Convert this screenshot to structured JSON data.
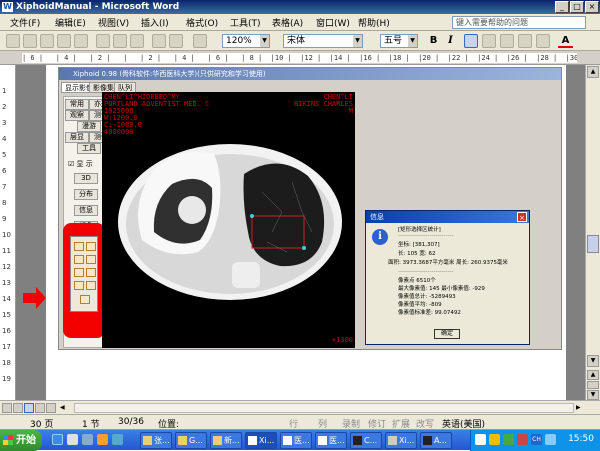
{
  "window": {
    "title": "XiphoidManual - Microsoft Word"
  },
  "menu": {
    "items": [
      "文件(F)",
      "编辑(E)",
      "视图(V)",
      "插入(I)",
      "格式(O)",
      "工具(T)",
      "表格(A)",
      "窗口(W)",
      "帮助(H)"
    ],
    "help_placeholder": "键入需要帮助的问题"
  },
  "toolbar": {
    "zoom": "120%",
    "font": "宋体",
    "size": "五号",
    "bold": "B",
    "italic": "I",
    "font_color": "A"
  },
  "ruler": {
    "text": "| 6 |   | 4 |   | 2 |   |   | 2 |   | 4 |   | 6 |   | 8 |  |10 |  |12 |  |14 |  |16 |  |18 |  |20 |  |22 |  |24 |  |26 |  |28 |  |30 |  |32 |  |34 |  |36 |  |38 |  |40 |  |42 |  |44 |  |46 |  |48 |"
  },
  "vruler": [
    "1",
    "2",
    "3",
    "4",
    "5",
    "6",
    "7",
    "8",
    "9",
    "10",
    "11",
    "12",
    "13",
    "14",
    "15",
    "16",
    "17",
    "18",
    "19"
  ],
  "xiphoid": {
    "title": "Xiphoid 0.98 (骨科软件:华西医科大学)(只供研究和学习使用)",
    "tabs": [
      "显示影像",
      "影像集",
      "队列"
    ],
    "left_buttons": [
      "常用",
      "亦形",
      "观察",
      "测位",
      "漫游",
      "层显",
      "测位",
      "工具"
    ],
    "checkbox_label": "显 示",
    "buttons": [
      "3D",
      "分布",
      "信息",
      "颜色",
      "操作"
    ],
    "ct_text_left": [
      "CHEN^LI^HIDEBED^MY",
      "PORTLAND ADVENTIST MED. C",
      "1025000",
      "W:1200.0",
      "C:-1080.0",
      "4000000"
    ],
    "ct_text_right": [
      "CHEN^LI",
      "BIKINS CHARLES",
      "M"
    ],
    "ct_window": "+1300",
    "dialog": {
      "title": "信息",
      "icon": "info-icon",
      "lines": [
        "[矩形选择区统计]",
        "----------------------------",
        "坐标: [381,307]",
        "长: 105 宽: 62",
        "面积: 3973.3687平方毫米   周长: 260.9375毫米",
        "----------------------------",
        "像素点 6510个",
        "最大像素值: 145  最小像素值: -929",
        "像素值总计: -5289493",
        "像素值平均: -809",
        "像素值标准差: 99.07492"
      ],
      "ok": "确定"
    }
  },
  "status": {
    "page": "30 页",
    "section": "1 节",
    "pos": "30/36",
    "at": "位置:",
    "row": "行",
    "col": "列",
    "rec": "录制",
    "rev": "修订",
    "ext": "扩展",
    "ovr": "改写",
    "lang": "英语(美国)"
  },
  "taskbar": {
    "start": "开始",
    "items": [
      "张...",
      "G...",
      "新...",
      "Xi...",
      "医...",
      "医...",
      "C...",
      "Xi...",
      "A..."
    ],
    "clock": "15:50"
  },
  "colors": {
    "title_bar": "#0a246a",
    "highlight_red": "#f20000",
    "taskbar": "#2357d0"
  }
}
